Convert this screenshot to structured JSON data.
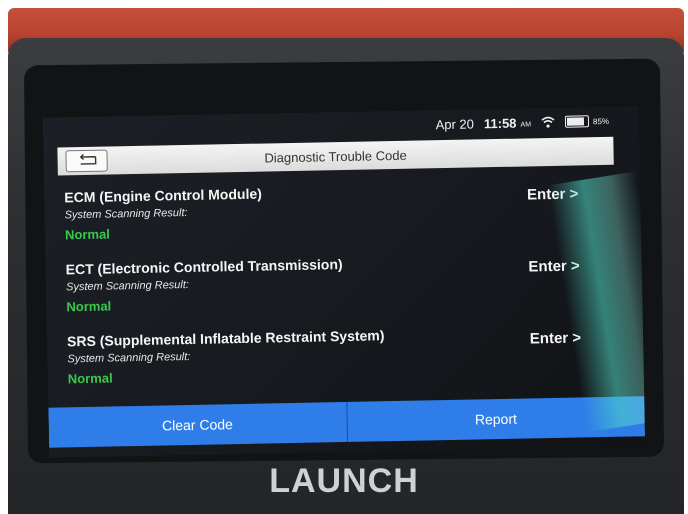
{
  "status_bar": {
    "date": "Apr 20",
    "time": "11:58",
    "ampm": "AM",
    "battery": "85%"
  },
  "header": {
    "title": "Diagnostic Trouble Code",
    "back_icon": "back-arrow-icon"
  },
  "systems": [
    {
      "name": "ECM (Engine Control Module)",
      "scan_label": "System Scanning Result:",
      "result": "Normal",
      "action": "Enter >"
    },
    {
      "name": "ECT (Electronic Controlled Transmission)",
      "scan_label": "System Scanning Result:",
      "result": "Normal",
      "action": "Enter >"
    },
    {
      "name": "SRS (Supplemental Inflatable Restraint System)",
      "scan_label": "System Scanning Result:",
      "result": "Normal",
      "action": "Enter >"
    }
  ],
  "footer": {
    "clear_label": "Clear Code",
    "report_label": "Report"
  },
  "device": {
    "brand": "LAUNCH"
  },
  "colors": {
    "normal": "#39c94b",
    "accent": "#2f7de8"
  }
}
